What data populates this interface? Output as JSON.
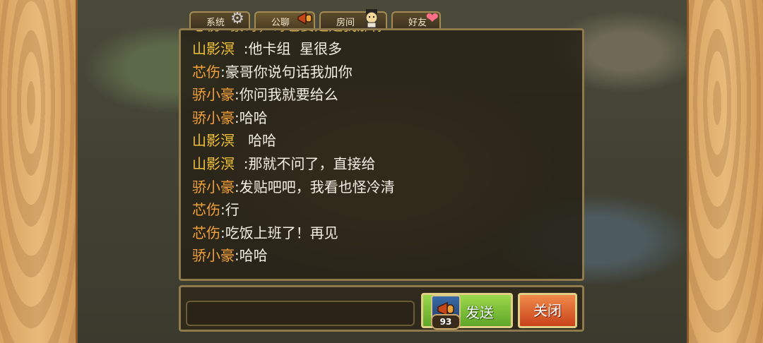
{
  "tabs": [
    {
      "label": "系统",
      "icon": "gear-icon"
    },
    {
      "label": "公聊",
      "icon": "horn-icon"
    },
    {
      "label": "房间",
      "icon": "character-icon"
    },
    {
      "label": "好友",
      "icon": "heart-icon"
    }
  ],
  "chat": {
    "partial_top_line": "芯伤: 豪哥，哥也要是是我那你",
    "messages": [
      {
        "name": "山影溟",
        "sep": "  :",
        "text": "他卡组  星很多"
      },
      {
        "name": "芯伤",
        "sep": ":",
        "text": "豪哥你说句话我加你"
      },
      {
        "name": "骄小豪",
        "sep": ":",
        "text": "你问我就要给么"
      },
      {
        "name": "骄小豪",
        "sep": ":",
        "text": "哈哈"
      },
      {
        "name": "山影溟",
        "sep": "   ",
        "text": "哈哈"
      },
      {
        "name": "山影溟",
        "sep": "  :",
        "text": "那就不问了，直接给"
      },
      {
        "name": "骄小豪",
        "sep": ":",
        "text": "发贴吧吧，我看也怪冷清"
      },
      {
        "name": "芯伤",
        "sep": ":",
        "text": "行"
      },
      {
        "name": "芯伤",
        "sep": ":",
        "text": "吃饭上班了！再见"
      },
      {
        "name": "骄小豪",
        "sep": ":",
        "text": "哈哈"
      }
    ]
  },
  "input": {
    "value": "",
    "placeholder": ""
  },
  "send_button": {
    "label": "发送",
    "item_count": "93",
    "item_icon": "horn-item-icon"
  },
  "close_button": {
    "label": "关闭"
  },
  "colors": {
    "name_orange": "#f5a23a",
    "name_yellow": "#f3c23a",
    "send_green": "#7cc23a",
    "close_red": "#e0632a"
  }
}
